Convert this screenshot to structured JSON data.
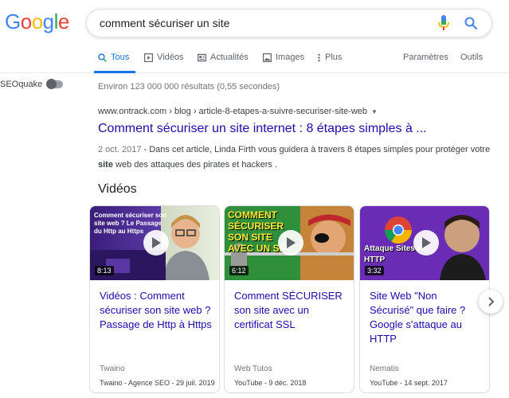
{
  "logo": {
    "text": [
      "G",
      "o",
      "o",
      "g",
      "l",
      "e"
    ],
    "colors": [
      "#4285F4",
      "#EA4335",
      "#FBBC05",
      "#4285F4",
      "#34A853",
      "#EA4335"
    ]
  },
  "search": {
    "query": "comment sécuriser un site"
  },
  "tabs": [
    {
      "label": "Tous",
      "icon": "search-icon",
      "active": true
    },
    {
      "label": "Vidéos",
      "icon": "video-icon"
    },
    {
      "label": "Actualités",
      "icon": "news-icon"
    },
    {
      "label": "Images",
      "icon": "image-icon"
    },
    {
      "label": "Plus",
      "icon": "more-vert-icon"
    }
  ],
  "tools": {
    "settings": "Paramètres",
    "tools": "Outils"
  },
  "seoquake": {
    "label": "SEOquake"
  },
  "stats": "Environ 123 000 000 résultats (0,55 secondes)",
  "result": {
    "url": "www.ontrack.com › blog › article-8-etapes-a-suivre-securiser-site-web",
    "title": "Comment sécuriser un site internet : 8 étapes simples à ...",
    "date": "2 oct. 2017",
    "snippet_before": " - Dans cet article, Linda Firth vous guidera à travers 8 étapes simples pour protéger votre ",
    "snippet_bold": "site",
    "snippet_after": " web des attaques des pirates et hackers ."
  },
  "videos": {
    "heading": "Vidéos",
    "items": [
      {
        "title": "Vidéos : Comment sécuriser son site web ? Passage de Http à Https",
        "source": "Twaino",
        "meta": "Twaino - Agence SEO - 29 juil. 2019",
        "duration": "8:13",
        "thumb_text": "Comment sécuriser son site web ? Le Passage du Http au Https"
      },
      {
        "title": "Comment SÉCURISER son site avec un certificat SSL",
        "source": "Web Tutos",
        "meta": "YouTube - 9 déc. 2018",
        "duration": "6:12",
        "thumb_text": "COMMENT SÉCURISER SON SITE AVEC UN SSL"
      },
      {
        "title": "Site Web \"Non Sécurisé\" que faire ? Google s'attaque au HTTP",
        "source": "Nematis",
        "meta": "YouTube - 14 sept. 2017",
        "duration": "3:32",
        "thumb_text": "Attaque Sites en HTTP"
      }
    ]
  }
}
